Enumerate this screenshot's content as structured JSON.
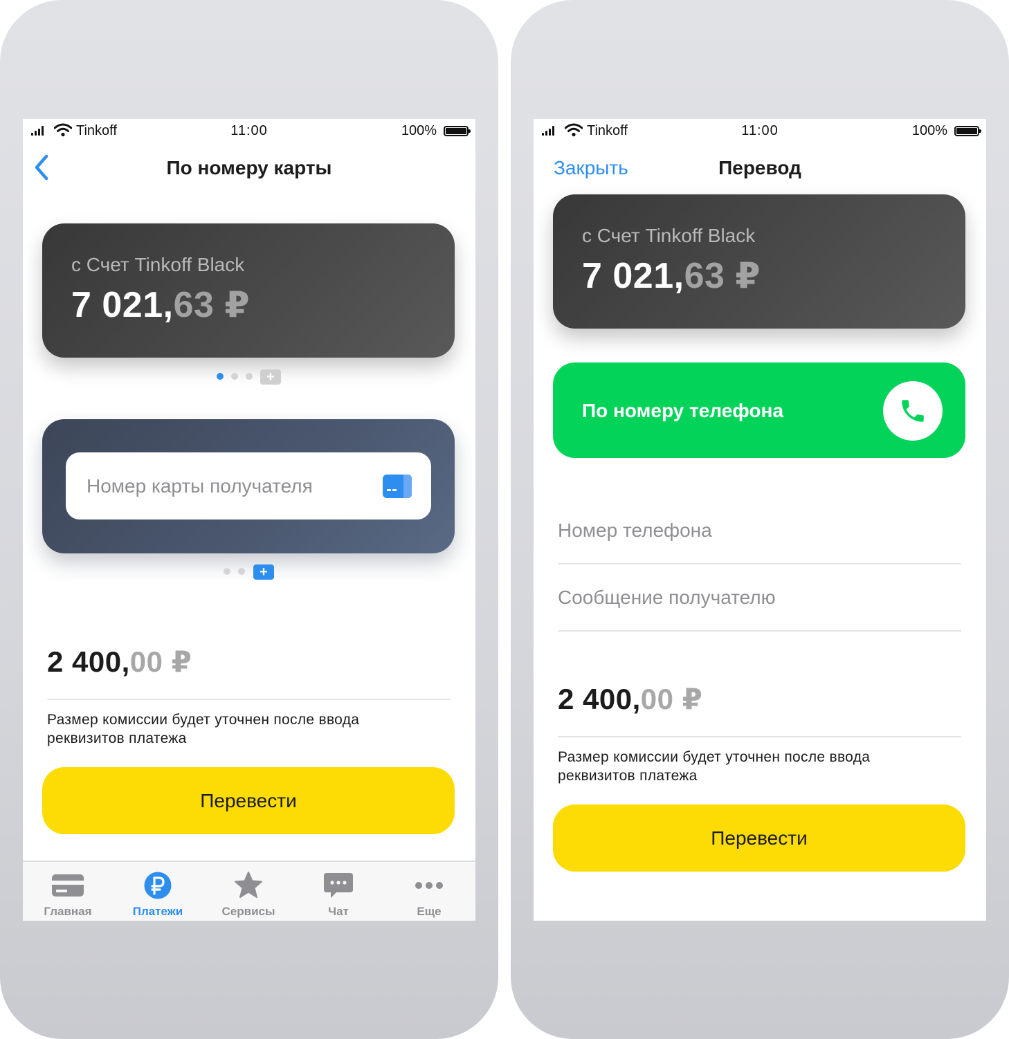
{
  "status_bar": {
    "carrier": "Tinkoff",
    "time": "11:00",
    "battery": "100%"
  },
  "screen_card": {
    "title": "По номеру карты",
    "source_account": {
      "label": "с Счет Tinkoff Black",
      "balance_int": "7 021,",
      "balance_dec": "63 ₽"
    },
    "recipient_placeholder": "Номер карты получателя",
    "amount_int": "2 400,",
    "amount_dec": "00 ₽",
    "commission_line1": "Размер комиссии будет уточнен после ввода",
    "commission_line2": "реквизитов платежа",
    "button_label": "Перевести",
    "plus_label": "+"
  },
  "screen_transfer": {
    "close_label": "Закрыть",
    "title": "Перевод",
    "source_account": {
      "label": "с Счет Tinkoff Black",
      "balance_int": "7 021,",
      "balance_dec": "63 ₽"
    },
    "phone_button_label": "По номеру телефона",
    "phone_placeholder": "Номер телефона",
    "message_placeholder": "Сообщение получателю",
    "amount_int": "2 400,",
    "amount_dec": "00 ₽",
    "commission_line1": "Размер комиссии будет уточнен после ввода",
    "commission_line2": "реквизитов платежа",
    "button_label": "Перевести"
  },
  "tab_bar": {
    "items": [
      {
        "label": "Главная",
        "icon": "card-icon",
        "active": false
      },
      {
        "label": "Платежи",
        "icon": "ruble-icon",
        "active": true
      },
      {
        "label": "Сервисы",
        "icon": "star-icon",
        "active": false
      },
      {
        "label": "Чат",
        "icon": "chat-icon",
        "active": false
      },
      {
        "label": "Еще",
        "icon": "more-icon",
        "active": false
      }
    ]
  },
  "colors": {
    "accent_blue": "#2d8ef0",
    "button_yellow": "#fcdc04",
    "phone_green": "#04d35a",
    "card_dark": "#444444",
    "card_slate": "#4b5870"
  }
}
